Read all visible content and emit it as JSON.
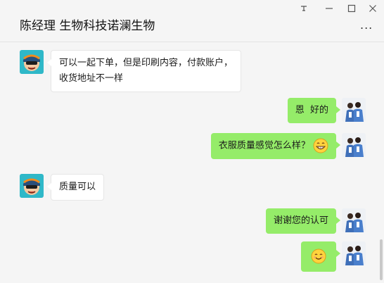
{
  "window": {
    "pin_icon": "pin-icon",
    "pin_glyph": "ꟸ",
    "min_glyph": "—",
    "max_glyph": "☐",
    "close_glyph": "✕"
  },
  "chat": {
    "title": "陈经理 生物科技诺澜生物",
    "more_label": "..."
  },
  "messages": [
    {
      "side": "left",
      "lines": [
        "可以一起下单，但是印刷内容，付款账户，",
        "收货地址不一样"
      ]
    },
    {
      "side": "right",
      "text": "恩  好的"
    },
    {
      "side": "right",
      "text": "衣服质量感觉怎么样？",
      "emoji": "grin-emoji"
    },
    {
      "side": "left",
      "text": "质量可以"
    },
    {
      "side": "right",
      "text": "谢谢您的认可"
    },
    {
      "side": "right",
      "text": "",
      "emoji": "smile-emoji"
    }
  ],
  "colors": {
    "self_bubble": "#95ec69",
    "other_bubble": "#ffffff",
    "background": "#f5f5f5"
  }
}
